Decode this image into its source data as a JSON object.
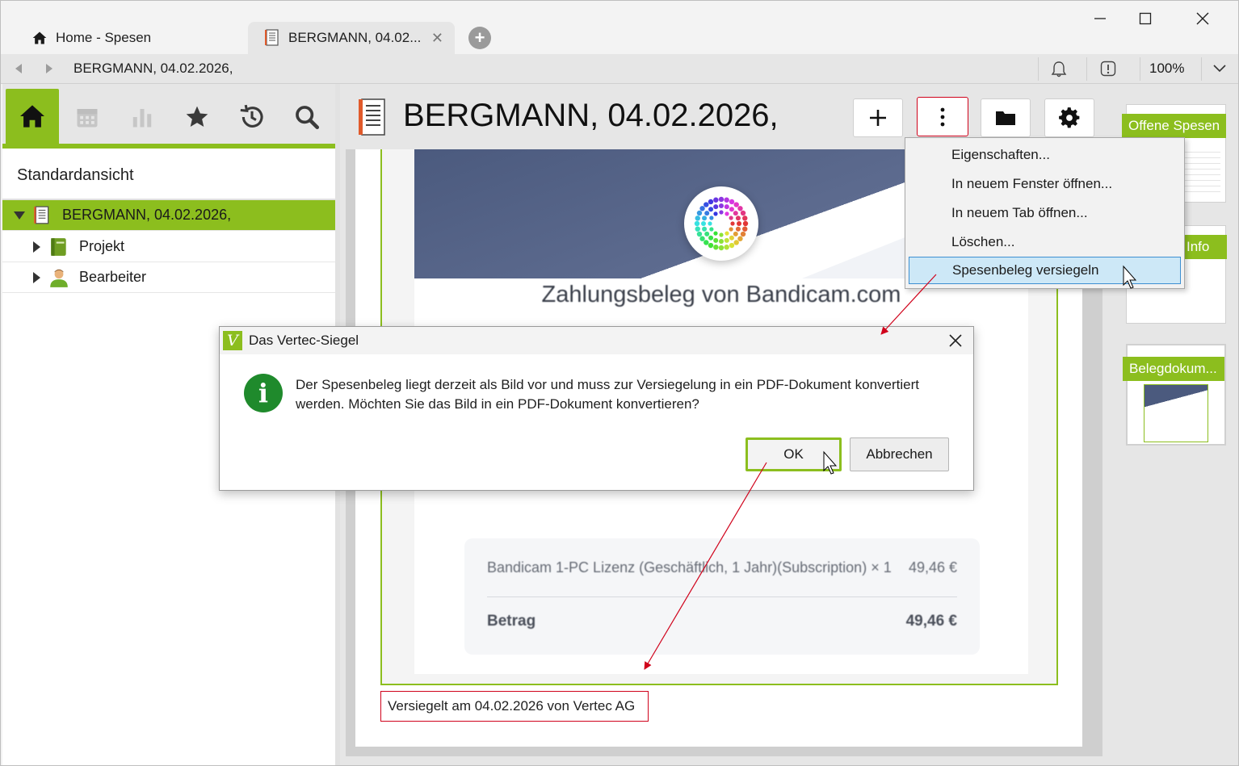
{
  "tabs": [
    {
      "label": "Home - Spesen",
      "icon": "home-icon"
    },
    {
      "label": "BERGMANN, 04.02...",
      "icon": "receipt-icon"
    }
  ],
  "address": {
    "path": "BERGMANN, 04.02.2026,",
    "zoom": "100%"
  },
  "left_panel": {
    "toolbar_icons": [
      "home-icon",
      "calendar-icon",
      "bar-chart-icon",
      "star-icon",
      "history-icon",
      "search-icon"
    ],
    "view_title": "Standardansicht",
    "tree": [
      {
        "label": "BERGMANN, 04.02.2026,",
        "expanded": true,
        "selected": true,
        "icon": "receipt-icon"
      },
      {
        "label": "Projekt",
        "expanded": false,
        "icon": "project-icon"
      },
      {
        "label": "Bearbeiter",
        "expanded": false,
        "icon": "user-icon"
      }
    ]
  },
  "document": {
    "title": "BERGMANN, 04.02.2026,",
    "toolbar": [
      "plus-icon",
      "more-vert-icon",
      "folder-icon",
      "gear-icon"
    ],
    "receipt_heading": "Zahlungsbeleg von Bandicam.com",
    "item_text": "Bandicam 1-PC Lizenz (Geschäftlich, 1 Jahr)(Subscription) × 1",
    "item_price": "49,46 €",
    "total_label": "Betrag",
    "total_value": "49,46 €",
    "seal_text": "Versiegelt am 04.02.2026 von Vertec AG"
  },
  "context_menu": {
    "items": [
      "Eigenschaften...",
      "In neuem Fenster öffnen...",
      "In neuem Tab öffnen...",
      "Löschen...",
      "Spesenbeleg versiegeln"
    ],
    "highlighted": "Spesenbeleg versiegeln"
  },
  "thumbnails": [
    {
      "label": "Offene Spesen"
    },
    {
      "label": "Info"
    },
    {
      "label": "Belegdokum..."
    }
  ],
  "dialog": {
    "title": "Das Vertec-Siegel",
    "logo_letter": "V",
    "message": "Der Spesenbeleg liegt derzeit als Bild vor und muss zur Versiegelung in ein PDF-Dokument konvertiert werden. Möchten Sie das Bild in ein PDF-Dokument konvertieren?",
    "ok_label": "OK",
    "cancel_label": "Abbrechen"
  },
  "colors": {
    "accent": "#8cbe1e",
    "highlight_red": "#d0021b",
    "menu_highlight": "#cde8f7",
    "info_green": "#1f8a2c"
  }
}
